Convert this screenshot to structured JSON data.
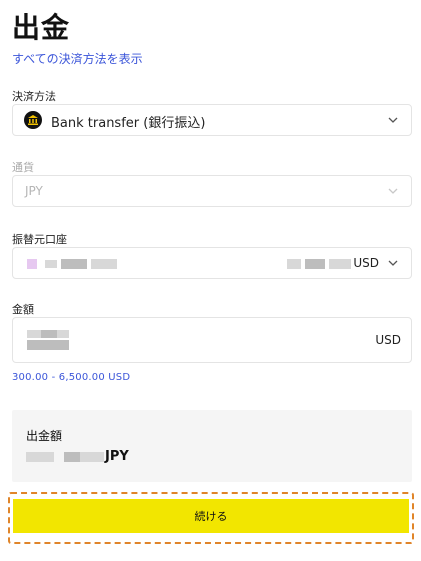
{
  "page": {
    "title": "出金",
    "show_all_methods_link": "すべての決済方法を表示"
  },
  "payment_method": {
    "label": "決済方法",
    "value": "Bank transfer (銀行振込)",
    "icon": "bank-icon"
  },
  "currency_field": {
    "label": "通貨",
    "value": "JPY"
  },
  "source_account": {
    "label": "振替元口座",
    "currency": "USD"
  },
  "amount": {
    "label": "金額",
    "unit": "USD",
    "range_hint": "300.00 - 6,500.00 USD"
  },
  "summary": {
    "label": "出金額",
    "currency": "JPY"
  },
  "continue_button": {
    "label": "続ける"
  },
  "colors": {
    "accent_button": "#f2e600",
    "link": "#3b55d9",
    "highlight_border": "#e0852a"
  }
}
